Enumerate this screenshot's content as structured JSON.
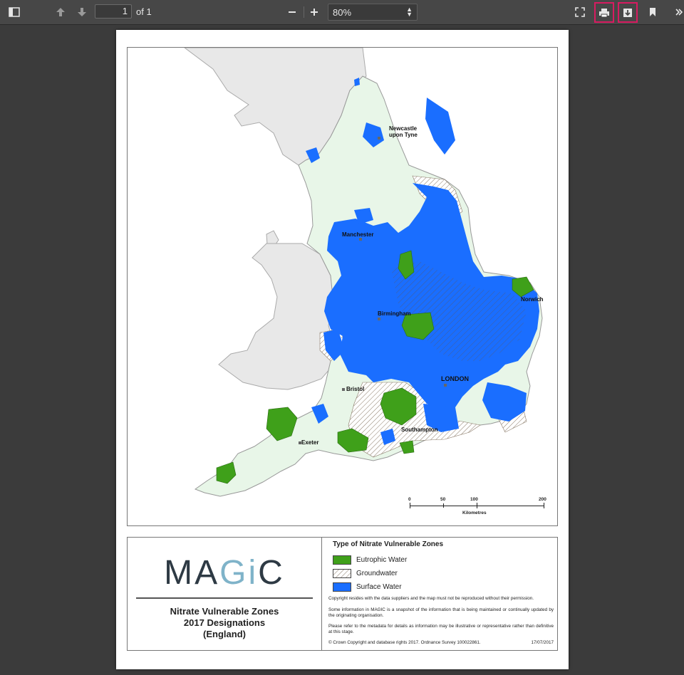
{
  "toolbar": {
    "page_number": "1",
    "page_of": "of 1",
    "zoom": "80%",
    "icons": [
      "sidebar-toggle-icon",
      "arrow-up-icon",
      "arrow-down-icon",
      "minus-icon",
      "plus-icon",
      "fullscreen-icon",
      "print-icon",
      "download-icon",
      "bookmark-icon",
      "more-tools-icon"
    ],
    "highlight_color": "#d81b60"
  },
  "map": {
    "places": {
      "newcastle": "Newcastle\nupon Tyne",
      "manchester": "Manchester",
      "norwich": "Norwich",
      "birmingham": "Birmingham",
      "london": "LONDON",
      "bristol": "Bristol",
      "southampton": "Southampton",
      "exeter": "Exeter"
    },
    "scale": {
      "ticks": [
        "0",
        "50",
        "100",
        "200"
      ],
      "unit": "Kilometres"
    },
    "colors": {
      "eutrophic": "#3fa01a",
      "surface": "#1a6eff",
      "land": "#e8f6e8",
      "other_land": "#e8e8e8"
    }
  },
  "legend": {
    "logo": "MAGiC",
    "title_lines": [
      "Nitrate Vulnerable Zones",
      "2017 Designations",
      "(England)"
    ],
    "heading": "Type of Nitrate Vulnerable Zones",
    "items": [
      "Eutrophic Water",
      "Groundwater",
      "Surface Water"
    ],
    "note_copyright": "Copyright resides with the data suppliers and the map must not be reproduced without their permission.",
    "note_snapshot": "Some information in MAGIC is a snapshot of the information that is being maintained or continually updated by the originating organisation.",
    "note_metadata": "Please refer to the metadata for details as information may be illustrative or representative rather than definitive at this stage.",
    "note_crown": "© Crown Copyright and database rights 2017. Ordnance Survey 100022861.",
    "date": "17/07/2017"
  }
}
